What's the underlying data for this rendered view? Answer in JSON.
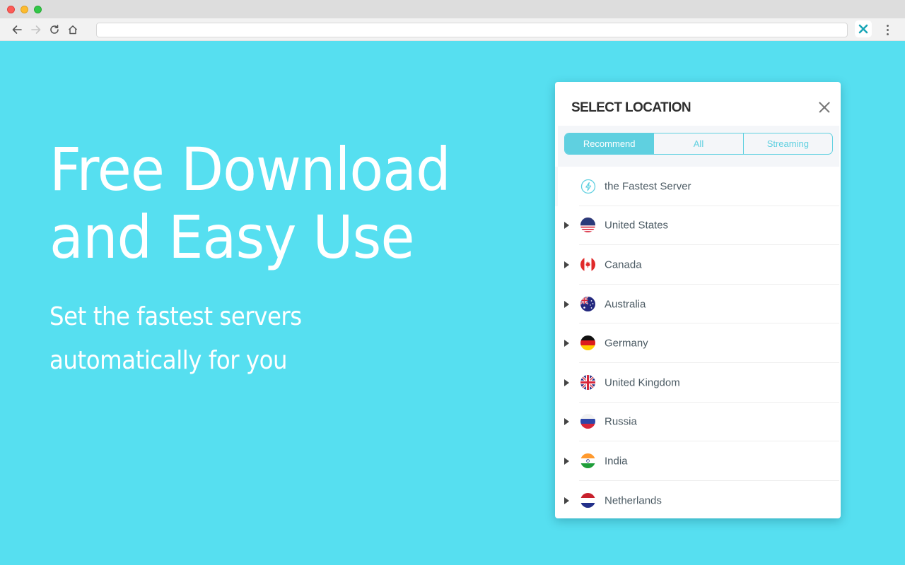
{
  "browser": {
    "url": "",
    "nav": {
      "back": "back-arrow-icon",
      "forward": "forward-arrow-icon",
      "reload": "reload-icon",
      "home": "home-icon"
    },
    "extension_icon": "x-vpn-extension-icon",
    "menu_icon": "kebab-menu-icon"
  },
  "hero": {
    "title_line1": "Free Download",
    "title_line2": "and Easy Use",
    "subtitle_line1": "Set the fastest servers",
    "subtitle_line2": "automatically for you"
  },
  "panel": {
    "title": "SELECT LOCATION",
    "close_icon": "close-icon",
    "tabs": [
      {
        "label": "Recommend",
        "active": true
      },
      {
        "label": "All",
        "active": false
      },
      {
        "label": "Streaming",
        "active": false
      }
    ],
    "fastest": {
      "label": "the Fastest Server",
      "icon": "lightning-bolt-icon"
    },
    "locations": [
      {
        "label": "United States",
        "flag": "us"
      },
      {
        "label": "Canada",
        "flag": "ca"
      },
      {
        "label": "Australia",
        "flag": "au"
      },
      {
        "label": "Germany",
        "flag": "de"
      },
      {
        "label": "United Kingdom",
        "flag": "gb"
      },
      {
        "label": "Russia",
        "flag": "ru"
      },
      {
        "label": "India",
        "flag": "in"
      },
      {
        "label": "Netherlands",
        "flag": "nl"
      }
    ]
  },
  "colors": {
    "background": "#56dff0",
    "accent": "#5fd0e0",
    "text": "#4b5a63"
  }
}
